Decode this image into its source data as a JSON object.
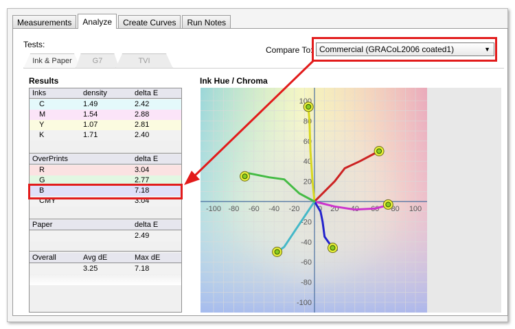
{
  "tabs": [
    {
      "label": "Measurements",
      "active": false
    },
    {
      "label": "Analyze",
      "active": true
    },
    {
      "label": "Create Curves",
      "active": false
    },
    {
      "label": "Run Notes",
      "active": false
    }
  ],
  "tests_label": "Tests:",
  "sub_tabs": [
    {
      "label": "Ink & Paper",
      "active": true
    },
    {
      "label": "G7",
      "active": false
    },
    {
      "label": "TVI",
      "active": false
    }
  ],
  "compare": {
    "label": "Compare To:",
    "selected": "Commercial (GRACoL2006 coated1)"
  },
  "results": {
    "title": "Results",
    "inks": {
      "headers": [
        "Inks",
        "density",
        "delta E"
      ],
      "rows": [
        {
          "name": "C",
          "density": "1.49",
          "delta_e": "2.42",
          "color": "#e4f9fb"
        },
        {
          "name": "M",
          "density": "1.54",
          "delta_e": "2.88",
          "color": "#fbe4f8"
        },
        {
          "name": "Y",
          "density": "1.07",
          "delta_e": "2.81",
          "color": "#fbfbe0"
        },
        {
          "name": "K",
          "density": "1.71",
          "delta_e": "2.40",
          "color": "#f0f0f0"
        }
      ]
    },
    "overprints": {
      "headers": [
        "OverPrints",
        "delta E"
      ],
      "rows": [
        {
          "name": "R",
          "delta_e": "3.04",
          "color": "#fbe2e2"
        },
        {
          "name": "G",
          "delta_e": "2.77",
          "color": "#e2f7e2"
        },
        {
          "name": "B",
          "delta_e": "7.18",
          "color": "#e0e0f8"
        },
        {
          "name": "CMY",
          "delta_e": "3.04",
          "color": "#f0f0f0"
        }
      ]
    },
    "paper": {
      "headers": [
        "Paper",
        "delta E"
      ],
      "value": "2.49"
    },
    "overall": {
      "headers": [
        "Overall",
        "Avg dE",
        "Max dE"
      ],
      "avg": "3.25",
      "max": "7.18"
    }
  },
  "chart_title": "Ink Hue / Chroma",
  "chart_data": {
    "type": "scatter",
    "title": "Ink Hue / Chroma",
    "xlim": [
      -110,
      110
    ],
    "ylim": [
      -110,
      110
    ],
    "x_ticks": [
      "-100",
      "-80",
      "-60",
      "-40",
      "-20",
      "0",
      "20",
      "40",
      "60",
      "80",
      "100"
    ],
    "y_ticks": [
      "100",
      "80",
      "60",
      "40",
      "20",
      "0",
      "-20",
      "-40",
      "-60",
      "-80",
      "-100"
    ],
    "grid": true,
    "series": [
      {
        "color": "#d8d820",
        "points": [
          [
            0,
            0
          ],
          [
            -2,
            20
          ],
          [
            -4,
            50
          ],
          [
            -5,
            80
          ],
          [
            -6,
            93
          ]
        ],
        "target": [
          -6,
          94
        ]
      },
      {
        "color": "#cc2222",
        "points": [
          [
            0,
            0
          ],
          [
            10,
            10
          ],
          [
            20,
            20
          ],
          [
            30,
            33
          ],
          [
            45,
            40
          ],
          [
            62,
            49
          ]
        ],
        "target": [
          64,
          50
        ]
      },
      {
        "color": "#cc33cc",
        "points": [
          [
            0,
            0
          ],
          [
            20,
            -5
          ],
          [
            40,
            -8
          ],
          [
            60,
            -7
          ],
          [
            75,
            -3
          ]
        ],
        "target": [
          73,
          -3
        ]
      },
      {
        "color": "#2222cc",
        "points": [
          [
            0,
            0
          ],
          [
            6,
            -10
          ],
          [
            8,
            -20
          ],
          [
            10,
            -35
          ],
          [
            15,
            -42
          ],
          [
            22,
            -48
          ]
        ],
        "target": [
          18,
          -46
        ]
      },
      {
        "color": "#44b8c8",
        "points": [
          [
            0,
            0
          ],
          [
            -10,
            -15
          ],
          [
            -20,
            -30
          ],
          [
            -30,
            -45
          ],
          [
            -38,
            -51
          ]
        ],
        "target": [
          -37,
          -50
        ]
      },
      {
        "color": "#44bb44",
        "points": [
          [
            0,
            0
          ],
          [
            -15,
            8
          ],
          [
            -30,
            22
          ],
          [
            -45,
            24
          ],
          [
            -65,
            28
          ]
        ],
        "target": [
          -69,
          25
        ]
      }
    ]
  }
}
